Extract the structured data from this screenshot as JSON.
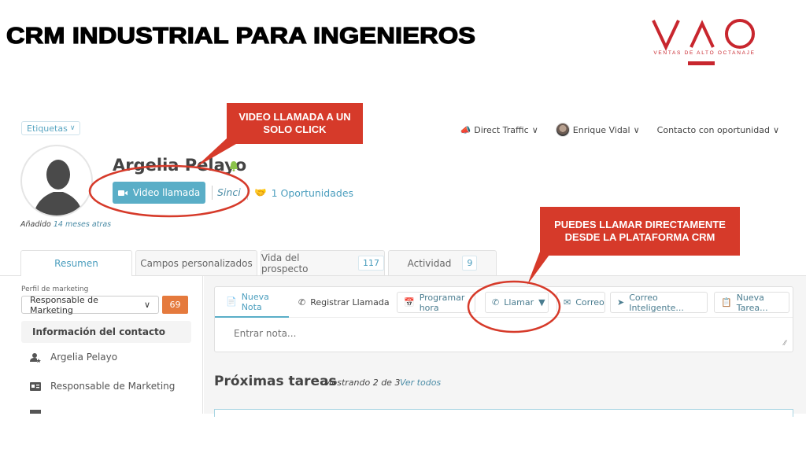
{
  "slide": {
    "title": "CRM INDUSTRIAL PARA INGENIEROS",
    "logo": {
      "mark": "VAO",
      "tagline": "VENTAS DE ALTO OCTANAJE",
      "color": "#c8262e"
    }
  },
  "annotations": {
    "video_callout": "VIDEO LLAMADA A UN SOLO CLICK",
    "call_callout": "PUEDES LLAMAR DIRECTAMENTE DESDE LA PLATAFORMA CRM",
    "color": "#d63a2a"
  },
  "crm": {
    "tags_button": "Etiquetas",
    "topbar": {
      "source": "Direct Traffic",
      "owner": "Enrique Vidal",
      "stage": "Contacto con oportunidad"
    },
    "contact": {
      "name": "Argelia Pelayo",
      "added_prefix": "Añadido",
      "added_ago": "14 meses atras",
      "video_button": "Video llamada",
      "sync_label": "Sinci",
      "opportunities": "1 Oportunidades"
    },
    "tabs": [
      {
        "label": "Resumen",
        "active": true
      },
      {
        "label": "Campos personalizados"
      },
      {
        "label": "Vida del prospecto",
        "count": "117"
      },
      {
        "label": "Actividad",
        "count": "9"
      }
    ],
    "left": {
      "marketing_label": "Perfil de marketing",
      "marketing_value": "Responsable de Marketing",
      "score": "69",
      "info_header": "Información del contacto",
      "info_rows": [
        "Argelia Pelayo",
        "Responsable de Marketing"
      ]
    },
    "composer": {
      "tabs": [
        "Nueva Nota",
        "Registrar Llamada"
      ],
      "buttons": [
        "Programar hora",
        "Llamar",
        "Correo",
        "Correo Inteligente...",
        "Nueva Tarea..."
      ],
      "note_placeholder": "Entrar nota..."
    },
    "tasks": {
      "title": "Próximas tareas",
      "meta": "Mostrando 2 de 3",
      "link": "Ver todos"
    },
    "colors": {
      "accent": "#5aaec7",
      "score": "#e57a3d",
      "link": "#4b8ca6"
    }
  }
}
